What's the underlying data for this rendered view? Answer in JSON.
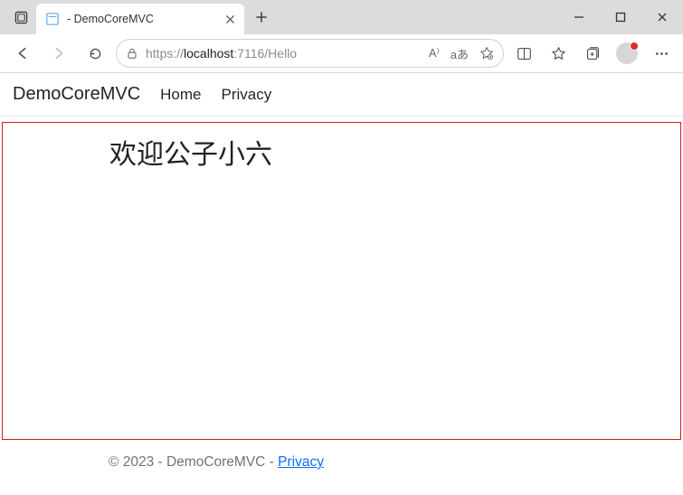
{
  "browser": {
    "tab_title": " - DemoCoreMVC",
    "url_prefix": "https://",
    "url_host": "localhost",
    "url_port_path": ":7116/Hello",
    "reader_label": "A⁾",
    "translate_label": "aあ"
  },
  "nav": {
    "brand": "DemoCoreMVC",
    "home": "Home",
    "privacy": "Privacy"
  },
  "main": {
    "heading": "欢迎公子小六"
  },
  "footer": {
    "copyright": "© 2023 - DemoCoreMVC - ",
    "privacy_link": "Privacy"
  }
}
